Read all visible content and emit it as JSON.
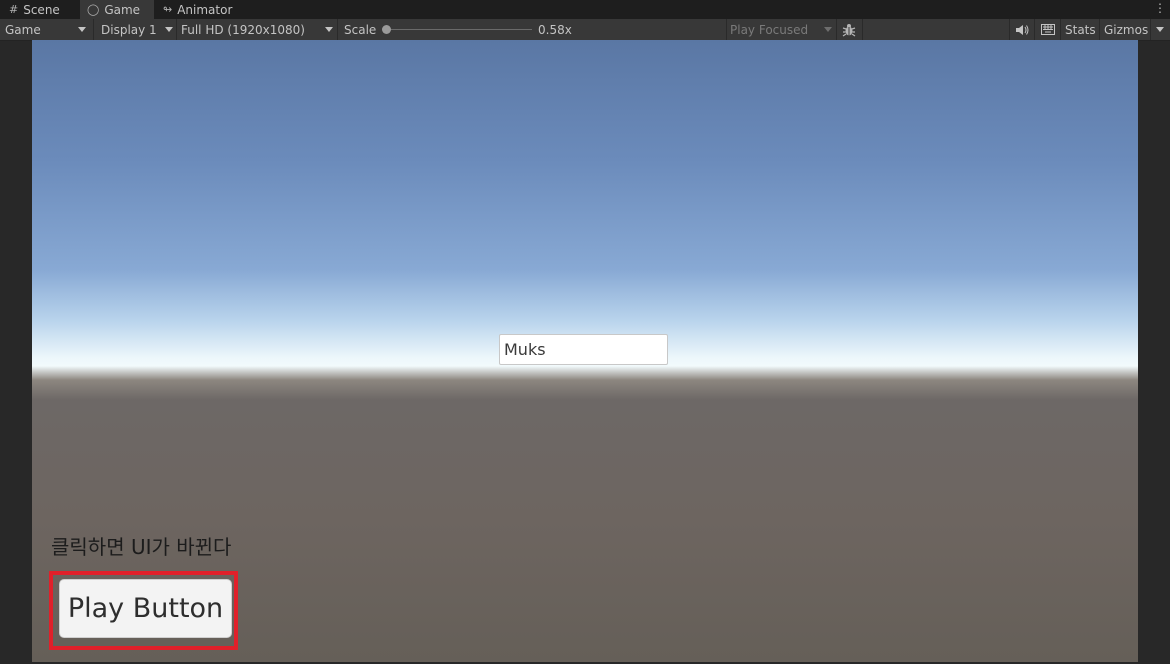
{
  "tabs": [
    {
      "label": "Scene",
      "icon": "grid-icon"
    },
    {
      "label": "Game",
      "icon": "gamepad-icon"
    },
    {
      "label": "Animator",
      "icon": "animator-icon"
    }
  ],
  "toolbar": {
    "view_mode": "Game",
    "display": "Display 1",
    "resolution": "Full HD (1920x1080)",
    "scale_label": "Scale",
    "scale_value": "0.58x",
    "scale_level": 0.0,
    "play_mode": "Play Focused",
    "stats": "Stats",
    "gizmos": "Gizmos"
  },
  "game": {
    "name_field_value": "Muks",
    "caption": "클릭하면 UI가 바뀐다",
    "play_button": "Play Button"
  },
  "colors": {
    "highlight": "#e0202a",
    "toolbar_bg": "#383838"
  }
}
